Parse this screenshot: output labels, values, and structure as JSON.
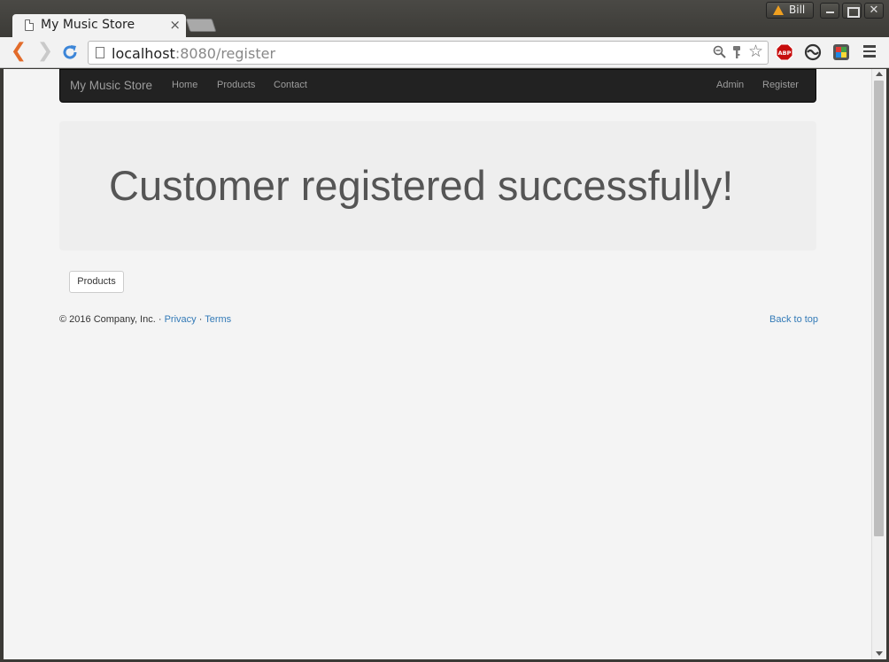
{
  "browser": {
    "tab_title": "My Music Store",
    "tab_close": "×",
    "profile_name": "Bill",
    "window_close": "✕",
    "url_host": "localhost",
    "url_rest": ":8080/register",
    "abp_label": "ABP"
  },
  "navbar": {
    "brand": "My Music Store",
    "links": [
      "Home",
      "Products",
      "Contact"
    ],
    "right_links": [
      "Admin",
      "Register"
    ]
  },
  "jumbotron": {
    "message": "Customer registered successfully!"
  },
  "products_button": "Products",
  "footer": {
    "copyright": "© 2016 Company, Inc. · ",
    "privacy": "Privacy",
    "separator": " · ",
    "terms": "Terms",
    "back_to_top": "Back to top"
  }
}
